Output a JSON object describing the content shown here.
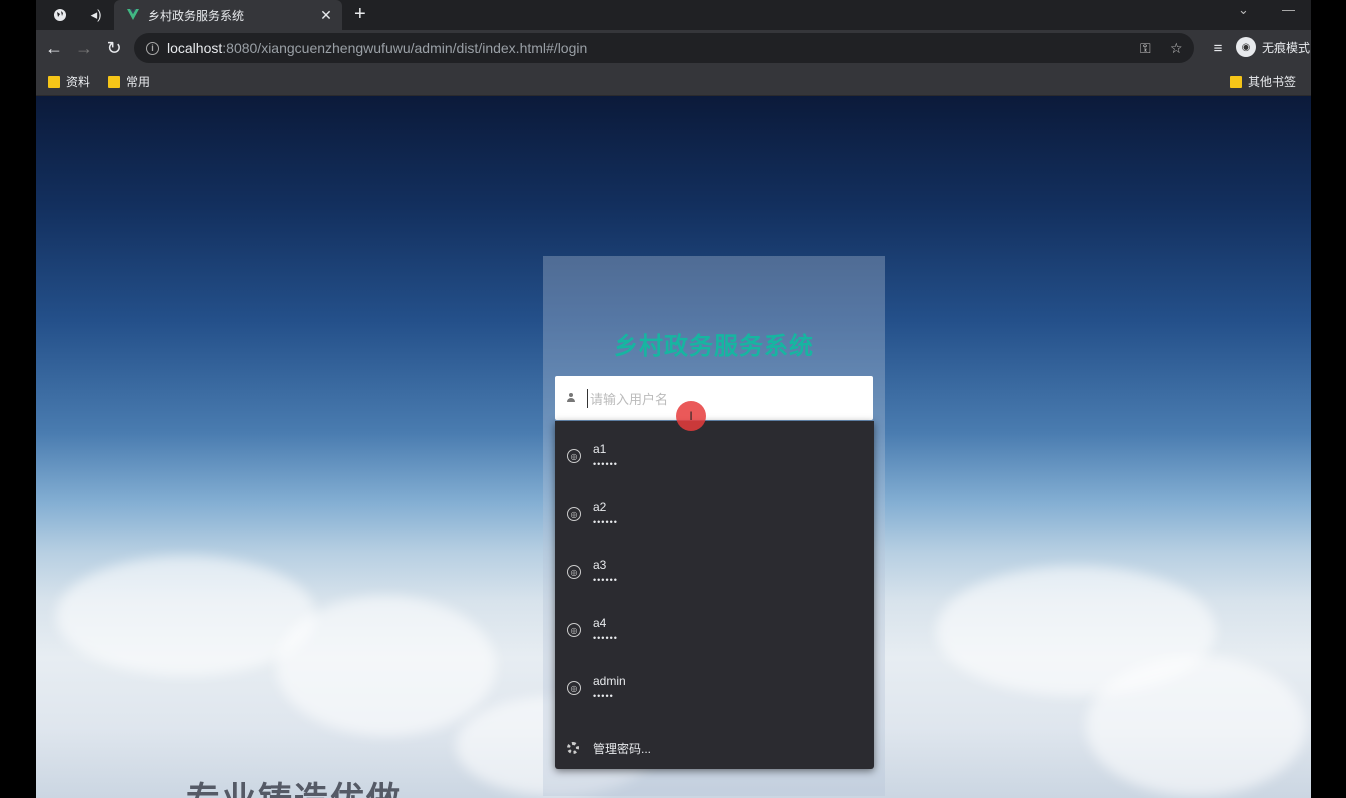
{
  "browser": {
    "tab_title": "乡村政务服务系统",
    "url_host": "localhost",
    "url_rest": ":8080/xiangcuenzhengwufuwu/admin/dist/index.html#/login",
    "profile_label": "无痕模式",
    "bookmarks": [
      "资料",
      "常用"
    ],
    "other_bookmarks": "其他书签"
  },
  "login": {
    "title": "乡村政务服务系统",
    "username_value": "请输入用户名"
  },
  "autofill": {
    "items": [
      {
        "user": "a1",
        "password": "••••••"
      },
      {
        "user": "a2",
        "password": "••••••"
      },
      {
        "user": "a3",
        "password": "••••••"
      },
      {
        "user": "a4",
        "password": "••••••"
      },
      {
        "user": "admin",
        "password": "•••••"
      }
    ],
    "manage_label": "管理密码..."
  },
  "page_text": {
    "slogan": "专业铸造优做"
  },
  "colors": {
    "title_accent": "#17b5a1",
    "dropdown_bg": "#2b2b30",
    "cursor_marker": "#e63c3c"
  },
  "icons": {
    "tab_favicon": "vue-logo-icon",
    "user_field": "user-icon",
    "autofill_item": "key-globe-icon",
    "manage": "gear-icon"
  }
}
